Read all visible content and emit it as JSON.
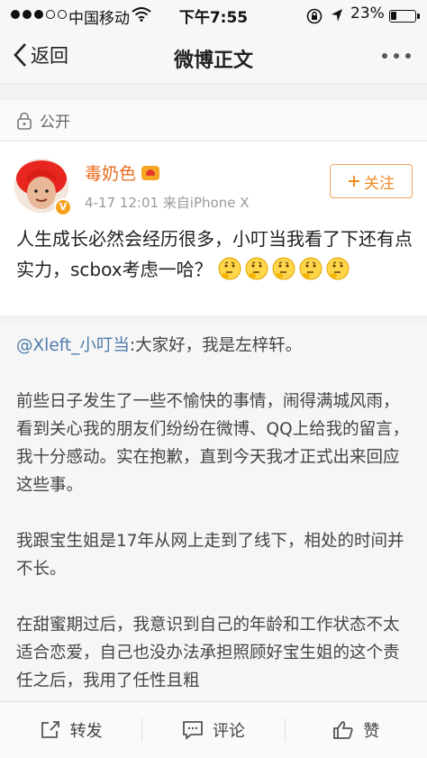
{
  "status_bar": {
    "carrier": "中国移动",
    "time": "下午7:55",
    "battery": "23%",
    "battery_level": 0.23,
    "signal_bars": 3
  },
  "nav": {
    "back_label": "返回",
    "title": "微博正文"
  },
  "visibility": "公开",
  "author": {
    "name": "毒奶色",
    "meta": "4-17 12:01  来自iPhone X",
    "follow_label": "关注"
  },
  "post": {
    "text": "人生成长必然会经历很多，小叮当我看了下还有点实力，scbox考虑一哈？"
  },
  "repost": {
    "mention": "@Xleft_小叮当",
    "first_line": ":大家好，我是左梓轩。",
    "paragraphs": [
      "前些日子发生了一些不愉快的事情，闹得满城风雨，看到关心我的朋友们纷纷在微博、QQ上给我的留言，我十分感动。实在抱歉，直到今天我才正式出来回应这些事。",
      "我跟宝生姐是17年从网上走到了线下，相处的时间并不长。",
      "在甜蜜期过后，我意识到自己的年龄和工作状态不太适合恋爱，自己也没办法承担照顾好宝生姐的这个责任之后，我用了任性且粗"
    ]
  },
  "toolbar": {
    "repost": "转发",
    "comment": "评论",
    "like": "赞"
  },
  "colors": {
    "accent": "#f08a24",
    "link": "#4f7cac",
    "name": "#e86b1f"
  },
  "icons": [
    "back-chevron-icon",
    "more-icon",
    "lock-icon",
    "verified-icon",
    "vip-icon",
    "thinking-emoji-icon",
    "share-icon",
    "comment-icon",
    "like-icon"
  ]
}
